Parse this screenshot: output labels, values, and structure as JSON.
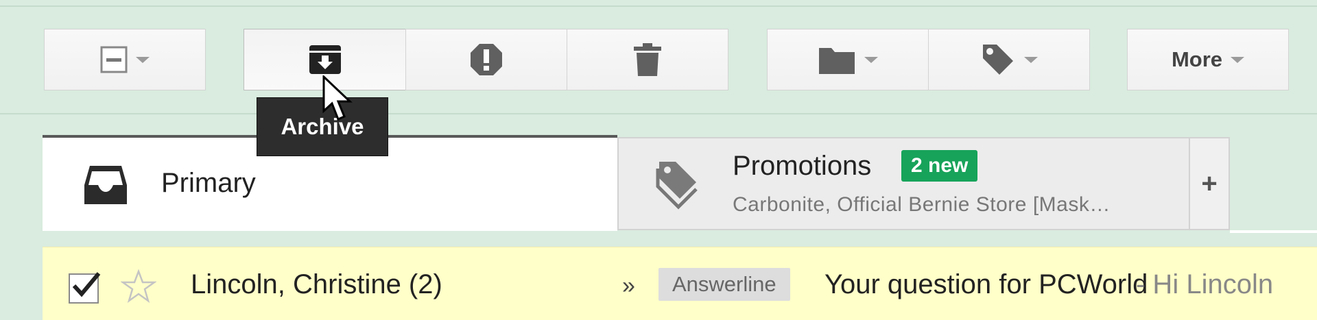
{
  "toolbar": {
    "select_icon": "select-checkbox-icon",
    "archive_icon": "archive-icon",
    "spam_icon": "report-spam-icon",
    "delete_icon": "trash-icon",
    "move_icon": "folder-icon",
    "labels_icon": "tag-icon",
    "more_label": "More"
  },
  "tooltip": {
    "text": "Archive"
  },
  "tabs": [
    {
      "label": "Primary",
      "icon": "inbox-icon"
    },
    {
      "label": "Promotions",
      "icon": "tag-icon",
      "badge": "2 new",
      "snippet": "Carbonite, Official Bernie Store [Mask…"
    }
  ],
  "add_tab_label": "+",
  "email": {
    "sender": "Lincoln, Christine (2)",
    "importance": "»",
    "label": "Answerline",
    "subject": "Your question for PCWorld",
    "snippet": " - Hi Lincoln"
  },
  "colors": {
    "background": "#d9ecdf",
    "unread_row": "#ffffc9",
    "badge": "#17a35a",
    "tooltip": "#2d2d2d"
  }
}
